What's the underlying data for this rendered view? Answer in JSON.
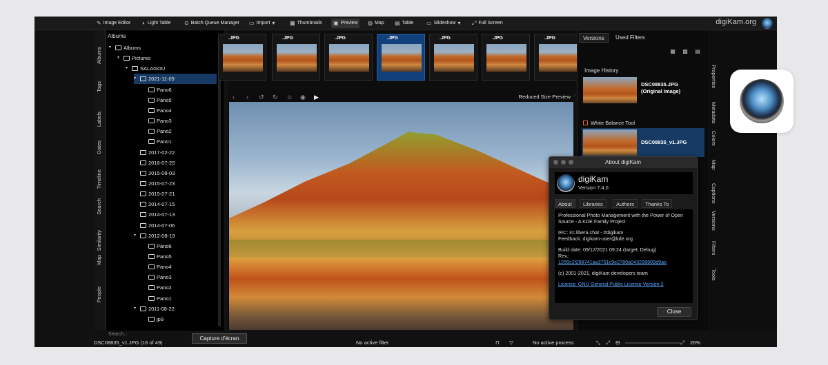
{
  "toolbar": {
    "items": [
      {
        "label": "Image Editor",
        "icon": "pencil-icon"
      },
      {
        "label": "Light Table",
        "icon": "light-table-icon"
      },
      {
        "label": "Batch Queue Manager",
        "icon": "batch-icon"
      },
      {
        "label": "Import",
        "icon": "import-icon"
      },
      {
        "label": "Thumbnails",
        "icon": "thumbnails-icon"
      },
      {
        "label": "Preview",
        "icon": "preview-icon"
      },
      {
        "label": "Map",
        "icon": "globe-icon"
      },
      {
        "label": "Table",
        "icon": "table-icon"
      },
      {
        "label": "Slideshow",
        "icon": "slideshow-icon"
      },
      {
        "label": "Full Screen",
        "icon": "fullscreen-icon"
      }
    ],
    "brand": "digiKam.org"
  },
  "left_tabs": [
    "Albums",
    "Tags",
    "Labels",
    "Dates",
    "Timeline",
    "Search",
    "Similarity",
    "Map",
    "People"
  ],
  "albums": {
    "title": "Albums",
    "tree": [
      {
        "label": "Albums",
        "level": 0
      },
      {
        "label": "Pictures",
        "level": 1
      },
      {
        "label": "SALAGOU",
        "level": 2
      },
      {
        "label": "2021-11-09",
        "level": 3
      },
      {
        "label": "Pano6",
        "level": 4
      },
      {
        "label": "Pano5",
        "level": 4
      },
      {
        "label": "Pano4",
        "level": 4
      },
      {
        "label": "Pano3",
        "level": 4
      },
      {
        "label": "Pano2",
        "level": 4
      },
      {
        "label": "Pano1",
        "level": 4
      },
      {
        "label": "2017-02-22",
        "level": 3
      },
      {
        "label": "2016-07-25",
        "level": 3
      },
      {
        "label": "2015-08-03",
        "level": 3
      },
      {
        "label": "2015-07-23",
        "level": 3
      },
      {
        "label": "2015-07-21",
        "level": 3
      },
      {
        "label": "2014-07-15",
        "level": 3
      },
      {
        "label": "2014-07-13",
        "level": 3
      },
      {
        "label": "2014-07-06",
        "level": 3
      },
      {
        "label": "2012-08-19",
        "level": 3
      },
      {
        "label": "Pano6",
        "level": 4
      },
      {
        "label": "Pano5",
        "level": 4
      },
      {
        "label": "Pano4",
        "level": 4
      },
      {
        "label": "Pano3",
        "level": 4
      },
      {
        "label": "Pano2",
        "level": 4
      },
      {
        "label": "Pano1",
        "level": 4
      },
      {
        "label": "2011-08-22",
        "level": 3
      },
      {
        "label": "jp9",
        "level": 4
      }
    ],
    "search_placeholder": "Search..."
  },
  "thumbnails": [
    ".JPG",
    ".JPG",
    ".JPG",
    ".JPG",
    ".JPG",
    ".JPG",
    ".JPG"
  ],
  "preview": {
    "label": "Reduced Size Preview"
  },
  "right_panel": {
    "tabs": [
      "Versions",
      "Used Filters"
    ],
    "history_title": "Image History",
    "items": [
      {
        "line1": "DSC08835.JPG",
        "line2": "(Original Image)"
      },
      {
        "line1": "DSC08835_v1.JPG",
        "line2": ""
      }
    ],
    "filter": "White Balance Tool"
  },
  "side_tabs": [
    "Properties",
    "Metadata",
    "Colors",
    "Map",
    "Captions",
    "Versions",
    "Filters",
    "Tools"
  ],
  "status": {
    "file": "DSC08835_v1.JPG (16 of 49)",
    "filter": "No active filter",
    "process": "No active process",
    "zoom": "26%"
  },
  "tooltip": "Capture d'écran",
  "about": {
    "title": "About digiKam",
    "name": "digiKam",
    "version": "Version 7.4.0",
    "tabs": [
      "About",
      "Libraries",
      "Authors",
      "Thanks To"
    ],
    "desc": "Professional Photo Management with the Power of Open Source - A KDE Family Project",
    "irc": "IRC: irc.libera.chat - #digikam",
    "feedback": "Feedback: digikam-user@kde.org",
    "build": "Build date: 09/12/2021 09:24 (target: Debug)",
    "rev_label": "Rev.:",
    "rev": "1255c2f288741aa3751c9e2780a043299809d9ae",
    "copyright": "(c) 2001-2021, digiKam developers team",
    "license": "License: GNU General Public License Version 2",
    "close": "Close"
  },
  "colors": {
    "selection": "#163a64",
    "link": "#5aa8ff",
    "accent": "#e07030"
  }
}
